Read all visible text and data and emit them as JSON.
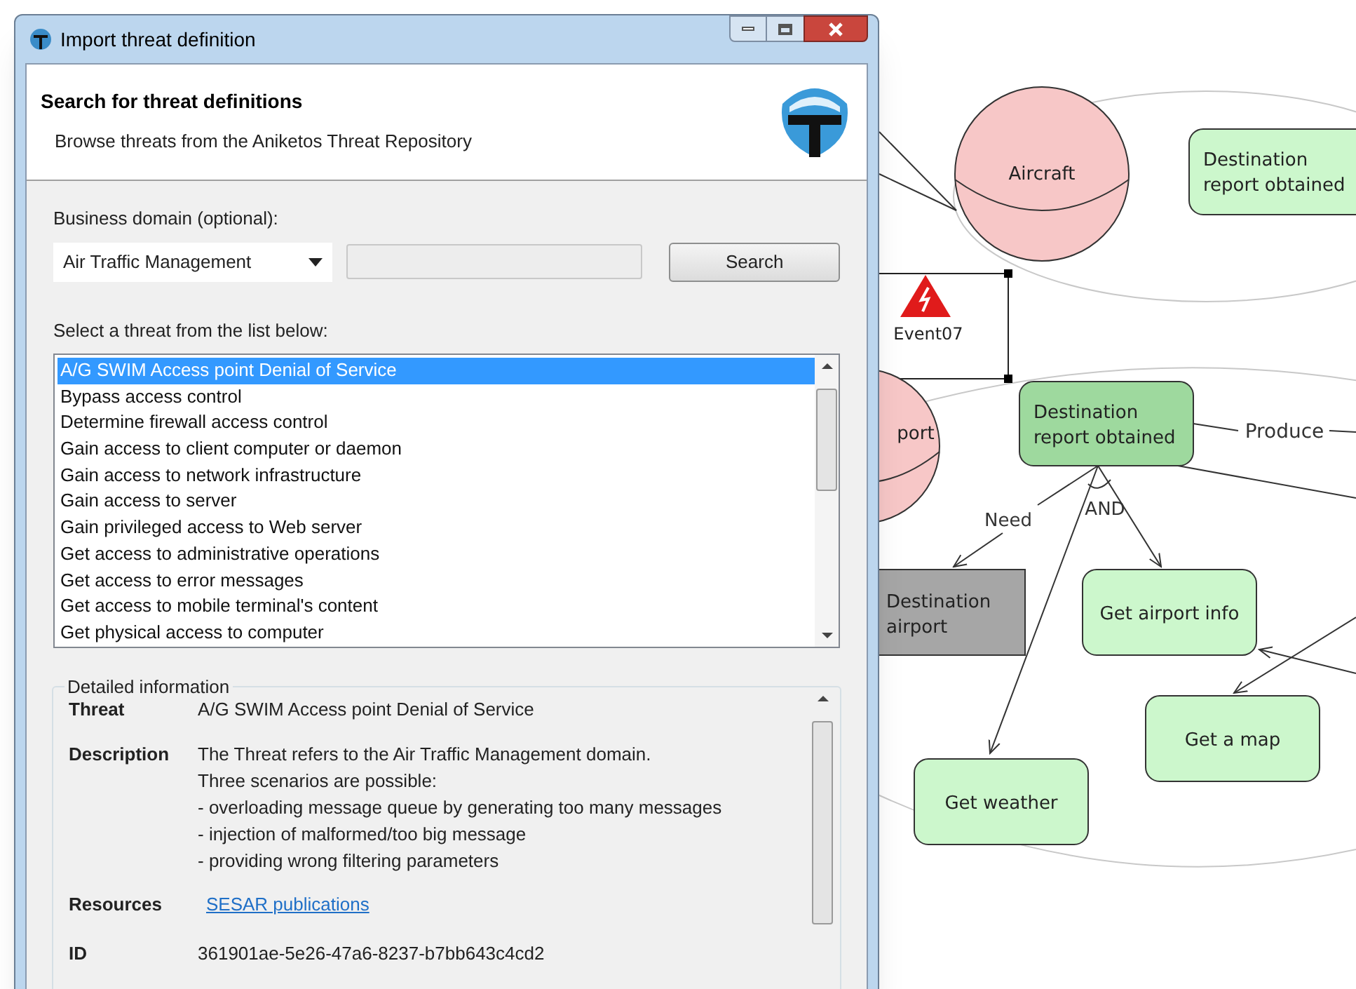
{
  "window": {
    "title": "Import threat definition"
  },
  "header": {
    "title": "Search for threat definitions",
    "subtitle": "Browse threats from the Aniketos Threat Repository"
  },
  "domain": {
    "label": "Business domain (optional):",
    "value": "Air Traffic Management"
  },
  "search_button": "Search",
  "list_label": "Select a threat from the list below:",
  "threats": [
    {
      "label": "A/G SWIM Access point Denial of Service",
      "selected": true
    },
    {
      "label": "Bypass access control",
      "selected": false
    },
    {
      "label": "Determine firewall access control",
      "selected": false
    },
    {
      "label": "Gain access to client computer or daemon",
      "selected": false
    },
    {
      "label": "Gain access to network infrastructure",
      "selected": false
    },
    {
      "label": "Gain access to server",
      "selected": false
    },
    {
      "label": "Gain privileged access to Web server",
      "selected": false
    },
    {
      "label": "Get access to administrative operations",
      "selected": false
    },
    {
      "label": "Get access to error messages",
      "selected": false
    },
    {
      "label": "Get access to mobile terminal's content",
      "selected": false
    },
    {
      "label": "Get physical access to computer",
      "selected": false
    }
  ],
  "details": {
    "title": "Detailed information",
    "fields": [
      {
        "kind": "text",
        "label": "Threat",
        "lines": [
          "A/G SWIM Access point Denial of Service"
        ]
      },
      {
        "kind": "text",
        "label": "Description",
        "lines": [
          "The Threat refers to the Air Traffic Management domain.",
          "Three scenarios are possible:",
          "- overloading message queue by generating too many messages",
          "- injection of malformed/too big message",
          "- providing wrong filtering parameters"
        ]
      },
      {
        "kind": "link",
        "label": "Resources",
        "lines": [
          "SESAR publications"
        ]
      },
      {
        "kind": "text",
        "label": "ID",
        "lines": [
          "361901ae-5e26-47a6-8237-b7bb643c4cd2"
        ]
      }
    ]
  },
  "diagram": {
    "nodes": [
      {
        "kind": "agent",
        "label": "Aircraft"
      },
      {
        "kind": "goal",
        "label": "Destination report obtained"
      },
      {
        "kind": "event",
        "label": "Event07"
      },
      {
        "kind": "agent",
        "label": "port"
      },
      {
        "kind": "goal_active",
        "label": "Destination report obtained"
      },
      {
        "kind": "resource",
        "label": "Destination airport"
      },
      {
        "kind": "goal",
        "label": "Get airport info"
      },
      {
        "kind": "goal",
        "label": "Get a map"
      },
      {
        "kind": "goal",
        "label": "Get weather"
      }
    ],
    "edge_labels": [
      "Produce",
      "Need",
      "AND"
    ]
  }
}
